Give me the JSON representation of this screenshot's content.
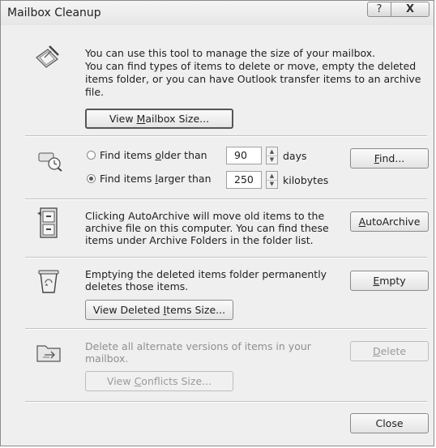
{
  "dialog": {
    "title": "Mailbox Cleanup",
    "help_glyph": "?",
    "close_glyph": "X"
  },
  "mailbox_section": {
    "line1": "You can use this tool to manage the size of your mailbox.",
    "line2": "You can find types of items to delete or move, empty the deleted",
    "line3": "items folder, or you can have Outlook transfer items to an archive",
    "line4": "file.",
    "view_size_pre": "View ",
    "view_size_key": "M",
    "view_size_post": "ailbox Size..."
  },
  "find_section": {
    "older_pre": "Find items ",
    "older_key": "o",
    "older_post": "lder than",
    "older_value": "90",
    "older_unit": "days",
    "older_checked": false,
    "larger_pre": "Find items ",
    "larger_key": "l",
    "larger_post": "arger than",
    "larger_value": "250",
    "larger_unit": "kilobytes",
    "larger_checked": true,
    "find_key": "F",
    "find_post": "ind..."
  },
  "autoarchive_section": {
    "line1": "Clicking AutoArchive will move old items to the",
    "line2": "archive file on this computer. You can find these",
    "line3": "items under Archive Folders in the folder list.",
    "btn_key": "A",
    "btn_post": "utoArchive"
  },
  "deleted_section": {
    "line1": "Emptying the deleted items folder permanently",
    "line2": "deletes those items.",
    "empty_key": "E",
    "empty_post": "mpty",
    "view_pre": "View Deleted ",
    "view_key": "I",
    "view_post": "tems Size..."
  },
  "conflicts_section": {
    "line1": "Delete all alternate versions of items in your",
    "line2": "mailbox.",
    "delete_key": "D",
    "delete_post": "elete",
    "view_pre": "View ",
    "view_key": "C",
    "view_post": "onflicts Size..."
  },
  "footer": {
    "close_label": "Close"
  },
  "icons": {
    "mailbox": "broom-cleanup-icon",
    "find": "clock-search-icon",
    "autoarchive": "filing-cabinet-icon",
    "deleted": "recycle-bin-icon",
    "conflicts": "conflict-folder-icon"
  }
}
